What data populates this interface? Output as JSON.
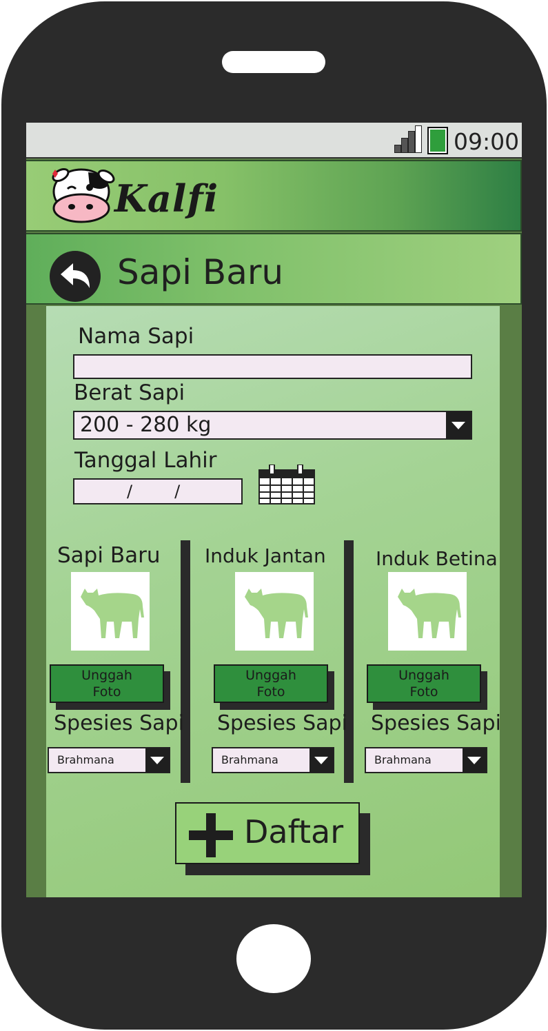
{
  "status_bar": {
    "time": "09:00",
    "battery_color": "#2f9e3c"
  },
  "app": {
    "logo_text": "Kalfi",
    "logo_icon": "cow-face-icon"
  },
  "header": {
    "title": "Sapi Baru",
    "back_icon": "back-arrow-icon"
  },
  "form": {
    "nama_label": "Nama Sapi",
    "nama_value": "",
    "berat_label": "Berat Sapi",
    "berat_value": "200 - 280 kg",
    "tanggal_label": "Tanggal Lahir",
    "tanggal_value": "/        /",
    "calendar_icon": "calendar-icon"
  },
  "photos": [
    {
      "title": "Sapi Baru",
      "upload_label": "Unggah\nFoto",
      "upload_line1": "Unggah",
      "upload_line2": "Foto",
      "species_label": "Spesies Sapi",
      "species_value": "Brahmana"
    },
    {
      "title": "Induk Jantan",
      "upload_line1": "Unggah",
      "upload_line2": "Foto",
      "species_label": "Spesies Sapi",
      "species_value": "Brahmana"
    },
    {
      "title": "Induk Betina",
      "upload_line1": "Unggah",
      "upload_line2": "Foto",
      "species_label": "Spesies Sapi",
      "species_value": "Brahmana"
    }
  ],
  "submit": {
    "label": "Daftar",
    "icon": "plus-icon"
  },
  "colors": {
    "accent": "#2f8f3d",
    "appbar_dark": "#2e7f44",
    "panel": "#a4d394"
  }
}
